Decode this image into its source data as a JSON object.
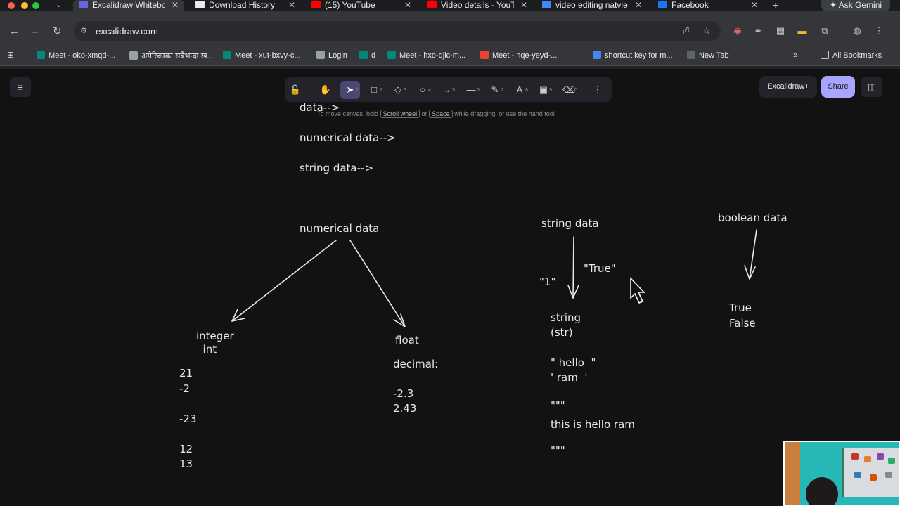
{
  "browser": {
    "tabs": [
      {
        "title": "Excalidraw Whiteboard",
        "active": true,
        "favicon_color": "#6965db"
      },
      {
        "title": "Download History",
        "active": false,
        "favicon_color": "#e8eaed"
      },
      {
        "title": "(15) YouTube",
        "active": false,
        "favicon_color": "#ff0000"
      },
      {
        "title": "Video details - YouTube",
        "active": false,
        "favicon_color": "#ff0000"
      },
      {
        "title": "video editing natvie s",
        "active": false,
        "favicon_color": "#4285f4"
      },
      {
        "title": "Facebook",
        "active": false,
        "favicon_color": "#1877f2"
      }
    ],
    "new_tab_symbol": "+",
    "ask_gemini_label": "Ask Gemini",
    "url": "excalidraw.com",
    "bookmarks": [
      {
        "label": "Meet - oko-xmqd-...",
        "icon": "meet-icon",
        "color": "#00897b"
      },
      {
        "label": "अमेरिकाका सबैभन्दा ख...",
        "icon": "globe-icon",
        "color": "#9aa0a6"
      },
      {
        "label": "Meet - xut-bxvy-c...",
        "icon": "meet-icon",
        "color": "#00897b"
      },
      {
        "label": "Login",
        "icon": "globe-icon",
        "color": "#9aa0a6"
      },
      {
        "label": "d",
        "icon": "meet-icon",
        "color": "#00897b"
      },
      {
        "label": "Meet - hxo-djic-m...",
        "icon": "meet-icon",
        "color": "#00897b"
      },
      {
        "label": "Meet - nqe-yeyd-...",
        "icon": "gmail-icon",
        "color": "#ea4335"
      },
      {
        "label": "shortcut key for m...",
        "icon": "google-icon",
        "color": "#4285f4"
      },
      {
        "label": "New Tab",
        "icon": "blank-icon",
        "color": "#5f6368"
      }
    ],
    "all_bookmarks_label": "All Bookmarks"
  },
  "excalidraw": {
    "tools": [
      {
        "name": "lock",
        "glyph": "🔓",
        "shortcut": ""
      },
      {
        "name": "hand",
        "glyph": "✋",
        "shortcut": ""
      },
      {
        "name": "selection",
        "glyph": "➤",
        "shortcut": "1"
      },
      {
        "name": "rectangle",
        "glyph": "□",
        "shortcut": "2"
      },
      {
        "name": "diamond",
        "glyph": "◇",
        "shortcut": "3"
      },
      {
        "name": "ellipse",
        "glyph": "○",
        "shortcut": "4"
      },
      {
        "name": "arrow",
        "glyph": "→",
        "shortcut": "5"
      },
      {
        "name": "line",
        "glyph": "—",
        "shortcut": "6"
      },
      {
        "name": "draw",
        "glyph": "✎",
        "shortcut": "7"
      },
      {
        "name": "text",
        "glyph": "A",
        "shortcut": "8"
      },
      {
        "name": "image",
        "glyph": "▣",
        "shortcut": "9"
      },
      {
        "name": "eraser",
        "glyph": "⌫",
        "shortcut": "0"
      },
      {
        "name": "more",
        "glyph": "⋮",
        "shortcut": ""
      }
    ],
    "plus_label": "Excalidraw+",
    "share_label": "Share",
    "hint": {
      "before": "To move canvas, hold",
      "key1": "Scroll wheel",
      "mid": "or",
      "key2": "Space",
      "after": "while dragging, or use the hand tool"
    },
    "canvas_text": {
      "data_heading": "data-->",
      "numerical_heading": "numerical data-->",
      "string_heading": "string data-->",
      "numerical_data": "numerical data",
      "integer": "integer\n  int",
      "int_values": "21\n-2\n\n-23\n\n12\n13",
      "float": "float",
      "decimal": "decimal:",
      "float_values": "-2.3\n2.43",
      "string_data": "string data",
      "one_quote": "\"1\"",
      "true_quote": "\"True\"",
      "string_str": "string\n(str)",
      "hello_ram": "\" hello  \"\n' ram  '",
      "triple_open": "\"\"\"",
      "this_is_hello_ram": "this is hello ram",
      "triple_close": "\"\"\"",
      "boolean_data": "boolean data",
      "true_false": "True\nFalse"
    }
  }
}
